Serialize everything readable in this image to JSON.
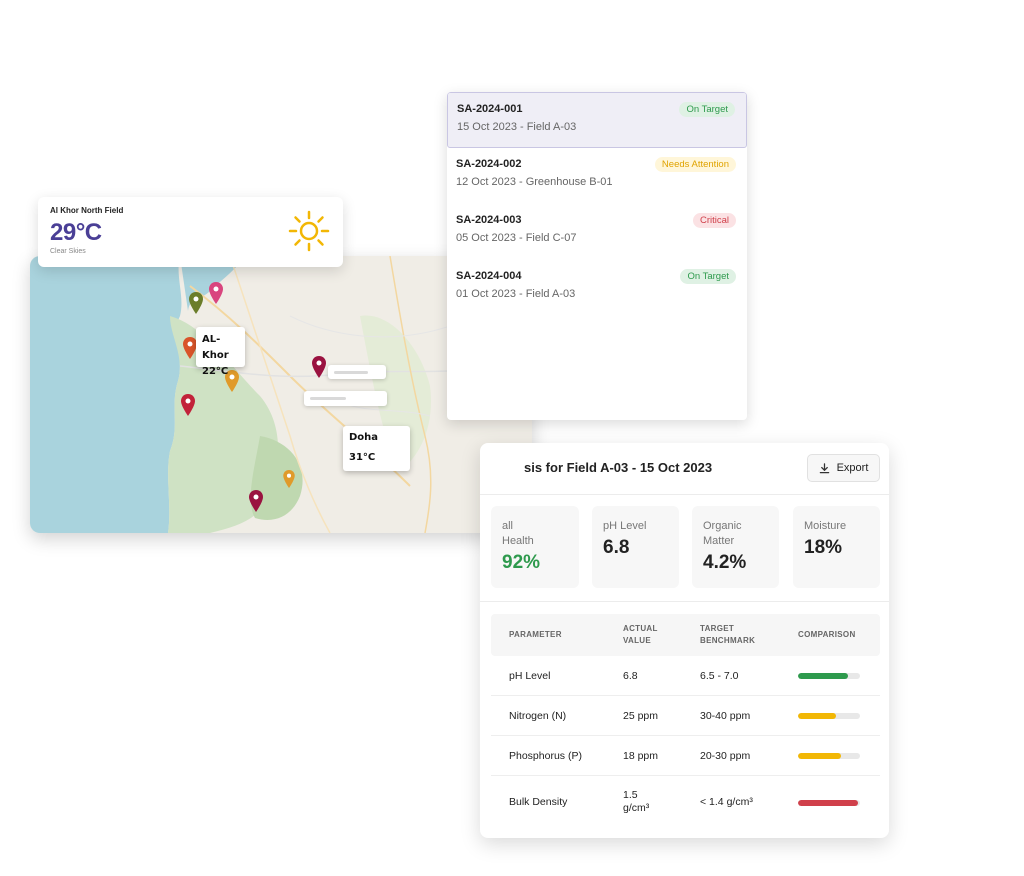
{
  "weather": {
    "location": "Al Khor North Field",
    "temperature": "29°C",
    "condition": "Clear Skies",
    "icon": "sun-icon",
    "icon_color": "#f2b705"
  },
  "map": {
    "labels": [
      {
        "city": "AL-Khor",
        "temp": "22°C"
      },
      {
        "city": "Doha",
        "temp": "31°C"
      }
    ],
    "pin_colors": [
      "#6b7d2a",
      "#d9457e",
      "#d9542a",
      "#e09a2a",
      "#c2223a",
      "#9a1240",
      "#e09a2a",
      "#9a1240"
    ]
  },
  "analyses": [
    {
      "id": "SA-2024-001",
      "meta": "15 Oct 2023 - Field A-03",
      "status": "On Target",
      "status_color": "green"
    },
    {
      "id": "SA-2024-002",
      "meta": "12 Oct 2023 - Greenhouse B-01",
      "status": "Needs Attention",
      "status_color": "yellow"
    },
    {
      "id": "SA-2024-003",
      "meta": "05 Oct 2023 - Field C-07",
      "status": "Critical",
      "status_color": "red"
    },
    {
      "id": "SA-2024-004",
      "meta": "01 Oct 2023 - Field A-03",
      "status": "On Target",
      "status_color": "green"
    }
  ],
  "detail": {
    "title": "sis for Field A-03 - 15 Oct 2023",
    "export_label": "Export",
    "stats": [
      {
        "label": "all\nHealth",
        "value": "92%"
      },
      {
        "label": "pH Level",
        "value": "6.8"
      },
      {
        "label": "Organic\nMatter",
        "value": "4.2%"
      },
      {
        "label": "Moisture",
        "value": "18%"
      }
    ],
    "table": {
      "headers": [
        "PARAMETER",
        "ACTUAL\nVALUE",
        "TARGET\nBENCHMARK",
        "COMPARISON"
      ],
      "rows": [
        {
          "parameter": "pH Level",
          "actual": "6.8",
          "target": "6.5 - 7.0",
          "comparison": 0.8,
          "color": "#2e9a4d"
        },
        {
          "parameter": "Nitrogen (N)",
          "actual": "25 ppm",
          "target": "30-40 ppm",
          "comparison": 0.62,
          "color": "#f2b705"
        },
        {
          "parameter": "Phosphorus (P)",
          "actual": "18 ppm",
          "target": "20-30 ppm",
          "comparison": 0.7,
          "color": "#f2b705"
        },
        {
          "parameter": "Bulk Density",
          "actual": "1.5\ng/cm³",
          "target": "< 1.4 g/cm³",
          "comparison": 0.96,
          "color": "#d0404b"
        }
      ]
    }
  }
}
